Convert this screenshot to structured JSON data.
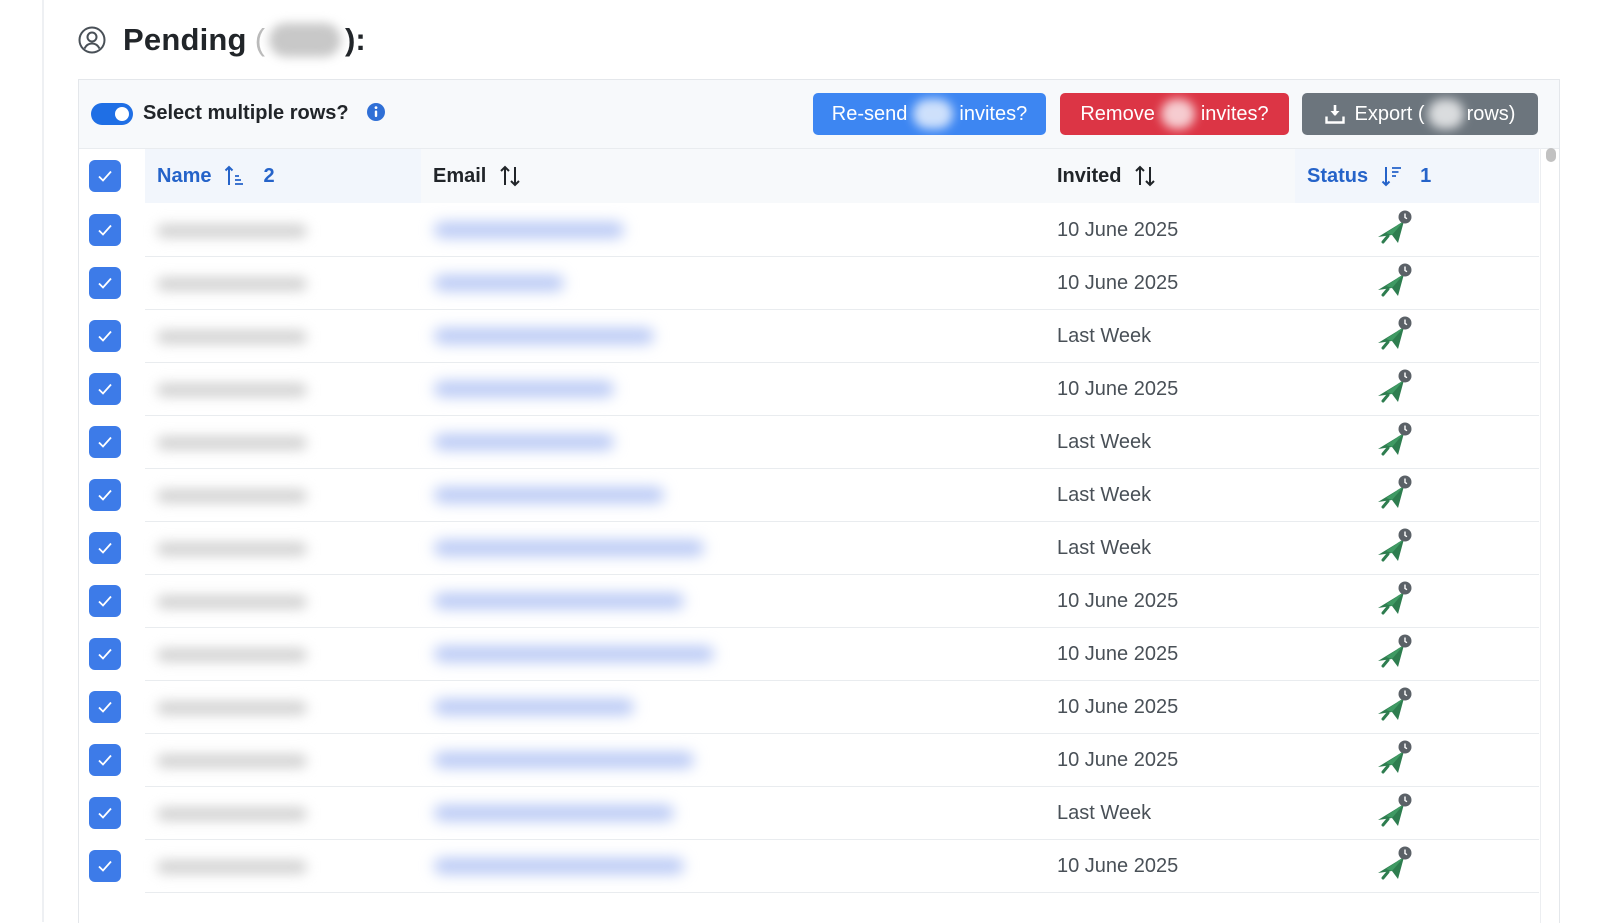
{
  "page": {
    "title": "Pending",
    "count_redacted": true,
    "colon": "):",
    "open_paren": "("
  },
  "toolbar": {
    "select_multiple_label": "Select multiple rows?",
    "toggle_on": true,
    "resend_prefix": "Re-send",
    "resend_suffix": "invites?",
    "remove_prefix": "Remove",
    "remove_suffix": "invites?",
    "export_prefix": "Export (",
    "export_suffix": "rows)"
  },
  "colors": {
    "primary": "#3d86f2",
    "danger": "#dc3545",
    "secondary": "#6c757d",
    "sorted_header": "#2563c9",
    "status_icon": "#2e7d4f"
  },
  "columns": [
    {
      "label": "Name",
      "sort": "ascending",
      "sort_order": "2"
    },
    {
      "label": "Email",
      "sort": "none",
      "sort_order": ""
    },
    {
      "label": "Invited",
      "sort": "none",
      "sort_order": ""
    },
    {
      "label": "Status",
      "sort": "descending",
      "sort_order": "1"
    }
  ],
  "rows": [
    {
      "selected": true,
      "invited": "10 June 2025",
      "status_icon": "sent-pending-icon"
    },
    {
      "selected": true,
      "invited": "10 June 2025",
      "status_icon": "sent-pending-icon"
    },
    {
      "selected": true,
      "invited": "Last Week",
      "status_icon": "sent-pending-icon"
    },
    {
      "selected": true,
      "invited": "10 June 2025",
      "status_icon": "sent-pending-icon"
    },
    {
      "selected": true,
      "invited": "Last Week",
      "status_icon": "sent-pending-icon"
    },
    {
      "selected": true,
      "invited": "Last Week",
      "status_icon": "sent-pending-icon"
    },
    {
      "selected": true,
      "invited": "Last Week",
      "status_icon": "sent-pending-icon"
    },
    {
      "selected": true,
      "invited": "10 June 2025",
      "status_icon": "sent-pending-icon"
    },
    {
      "selected": true,
      "invited": "10 June 2025",
      "status_icon": "sent-pending-icon"
    },
    {
      "selected": true,
      "invited": "10 June 2025",
      "status_icon": "sent-pending-icon"
    },
    {
      "selected": true,
      "invited": "10 June 2025",
      "status_icon": "sent-pending-icon"
    },
    {
      "selected": true,
      "invited": "Last Week",
      "status_icon": "sent-pending-icon"
    },
    {
      "selected": true,
      "invited": "10 June 2025",
      "status_icon": "sent-pending-icon"
    }
  ]
}
